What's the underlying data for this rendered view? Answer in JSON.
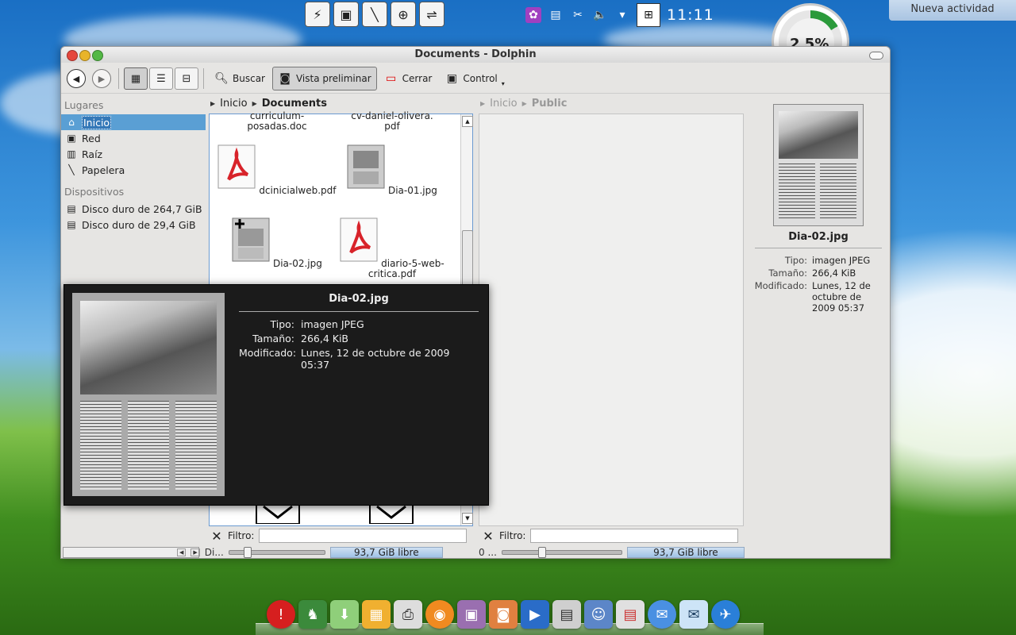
{
  "desktop": {
    "new_activity": "Nueva actividad",
    "clock": "11:11",
    "gauge_text": "2 5%"
  },
  "window": {
    "title": "Documents - Dolphin"
  },
  "toolbar": {
    "search_label": "Buscar",
    "preview_label": "Vista preliminar",
    "close_label": "Cerrar",
    "control_label": "Control"
  },
  "places": {
    "title": "Lugares",
    "items": [
      {
        "label": "Inicio",
        "icon": "home-icon"
      },
      {
        "label": "Red",
        "icon": "network-icon"
      },
      {
        "label": "Raíz",
        "icon": "root-icon"
      },
      {
        "label": "Papelera",
        "icon": "trash-icon"
      }
    ],
    "devices_title": "Dispositivos",
    "devices": [
      {
        "label": "Disco duro de 264,7 GiB"
      },
      {
        "label": "Disco duro de 29,4 GiB"
      }
    ]
  },
  "left_view": {
    "crumbs": [
      "Inicio",
      "Documents"
    ],
    "files": [
      {
        "name": "curriculum-\nposadas.doc"
      },
      {
        "name": "cv-daniel-olivera.\npdf"
      },
      {
        "name": "dcinicialweb.pdf"
      },
      {
        "name": "Dia-01.jpg"
      },
      {
        "name": "Dia-02.jpg"
      },
      {
        "name": "diario-5-web-\ncritica.pdf"
      }
    ],
    "filter_label": "Filtro:",
    "status": "Di...",
    "free_space": "93,7 GiB libre",
    "zoom_value": 0.15
  },
  "right_view": {
    "crumbs": [
      "Inicio",
      "Public"
    ],
    "filter_label": "Filtro:",
    "status": "0 ...",
    "free_space": "93,7 GiB libre",
    "zoom_value": 0.3
  },
  "info_panel": {
    "name": "Dia-02.jpg",
    "rows": [
      {
        "k": "Tipo:",
        "v": "imagen JPEG"
      },
      {
        "k": "Tamaño:",
        "v": "266,4 KiB"
      },
      {
        "k": "Modificado:",
        "v": "Lunes, 12 de octubre de 2009 05:37"
      }
    ]
  },
  "tooltip": {
    "name": "Dia-02.jpg",
    "rows": [
      {
        "k": "Tipo:",
        "v": "imagen JPEG"
      },
      {
        "k": "Tamaño:",
        "v": "266,4 KiB"
      },
      {
        "k": "Modificado:",
        "v": "Lunes, 12 de octubre de 2009 05:37"
      }
    ]
  },
  "colors": {
    "selection": "#5a9fd4",
    "pdf_red": "#d8232a"
  }
}
